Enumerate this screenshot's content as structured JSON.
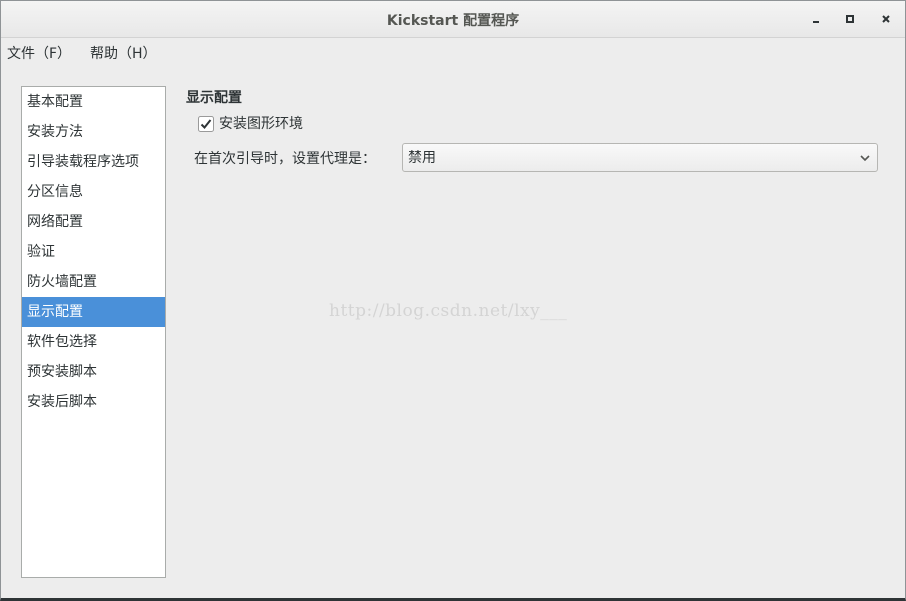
{
  "window": {
    "title": "Kickstart 配置程序"
  },
  "menu": {
    "file": "文件（F）",
    "help": "帮助（H）"
  },
  "sidebar": {
    "items": [
      {
        "label": "基本配置"
      },
      {
        "label": "安装方法"
      },
      {
        "label": "引导装载程序选项"
      },
      {
        "label": "分区信息"
      },
      {
        "label": "网络配置"
      },
      {
        "label": "验证"
      },
      {
        "label": "防火墙配置"
      },
      {
        "label": "显示配置",
        "selected": true
      },
      {
        "label": "软件包选择"
      },
      {
        "label": "预安装脚本"
      },
      {
        "label": "安装后脚本"
      }
    ]
  },
  "main": {
    "section_title": "显示配置",
    "install_graphical": {
      "label": "安装图形环境",
      "checked": true
    },
    "first_boot_label": "在首次引导时，设置代理是：",
    "first_boot_value": "禁用"
  },
  "watermark": "http://blog.csdn.net/lxy___",
  "colors": {
    "selection": "#4a90d9",
    "background": "#ededed"
  },
  "icons": {
    "minimize": "minimize-icon",
    "maximize": "maximize-icon",
    "close": "close-icon",
    "dropdown": "chevron-down-icon",
    "checkbox": "checkmark-icon"
  }
}
